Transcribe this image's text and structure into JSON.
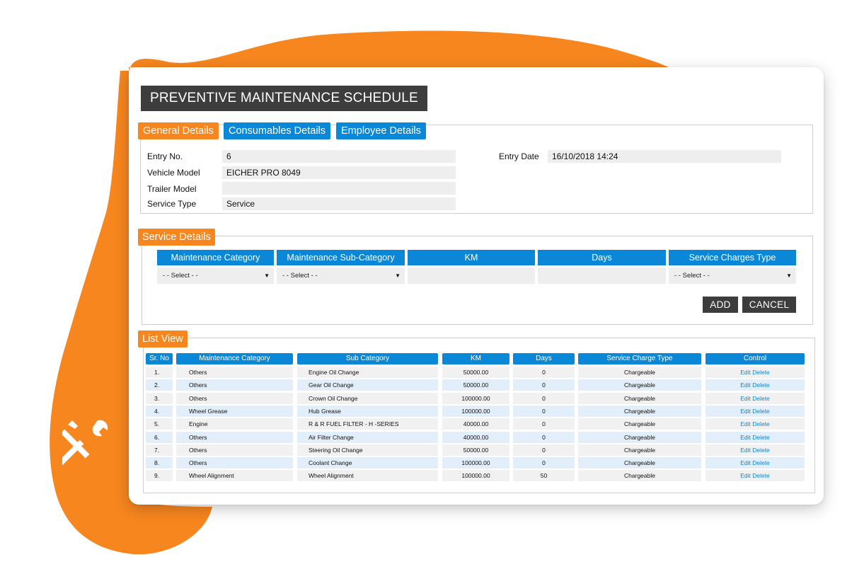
{
  "page_title": "PREVENTIVE MAINTENANCE SCHEDULE",
  "colors": {
    "accent_orange": "#f7861e",
    "header_blue": "#0a87d6",
    "dark_button": "#3d3d3d"
  },
  "tabs": [
    {
      "label": "General Details",
      "active": true
    },
    {
      "label": "Consumables Details",
      "active": false
    },
    {
      "label": "Employee Details",
      "active": false
    }
  ],
  "general": {
    "entry_no_label": "Entry No.",
    "entry_no_value": "6",
    "vehicle_model_label": "Vehicle Model",
    "vehicle_model_value": "EICHER PRO 8049",
    "trailer_model_label": "Trailer Model",
    "trailer_model_value": "",
    "service_type_label": "Service Type",
    "service_type_value": "Service",
    "entry_date_label": "Entry Date",
    "entry_date_value": "16/10/2018 14:24"
  },
  "service_details": {
    "legend": "Service Details",
    "headers": [
      "Maintenance Category",
      "Maintenance Sub-Category",
      "KM",
      "Days",
      "Service Charges Type"
    ],
    "maintenance_category_value": "- - Select - -",
    "maintenance_subcategory_value": "- - Select - -",
    "km_value": "",
    "days_value": "",
    "service_charges_type_value": "- - Select - -",
    "add_label": "ADD",
    "cancel_label": "CANCEL"
  },
  "list_view": {
    "legend": "List View",
    "headers": [
      "Sr. No",
      "Maintenance Category",
      "Sub Category",
      "KM",
      "Days",
      "Service Charge Type",
      "Control"
    ],
    "rows": [
      {
        "sr": "1.",
        "category": "Others",
        "sub": "Engine Oil Change",
        "km": "50000.00",
        "days": "0",
        "charge": "Chargeable",
        "control": "Edit Delete"
      },
      {
        "sr": "2.",
        "category": "Others",
        "sub": "Gear Oil Change",
        "km": "50000.00",
        "days": "0",
        "charge": "Chargeable",
        "control": "Edit Delete"
      },
      {
        "sr": "3.",
        "category": "Others",
        "sub": "Crown Oil Change",
        "km": "100000.00",
        "days": "0",
        "charge": "Chargeable",
        "control": "Edit Delete"
      },
      {
        "sr": "4.",
        "category": "Wheel Grease",
        "sub": "Hub Grease",
        "km": "100000.00",
        "days": "0",
        "charge": "Chargeable",
        "control": "Edit Delete"
      },
      {
        "sr": "5.",
        "category": "Engine",
        "sub": "R & R FUEL FILTER - H -SERIES",
        "km": "40000.00",
        "days": "0",
        "charge": "Chargeable",
        "control": "Edit Delete"
      },
      {
        "sr": "6.",
        "category": "Others",
        "sub": "Air Filter Change",
        "km": "40000.00",
        "days": "0",
        "charge": "Chargeable",
        "control": "Edit Delete"
      },
      {
        "sr": "7.",
        "category": "Others",
        "sub": "Steering Oil Change",
        "km": "50000.00",
        "days": "0",
        "charge": "Chargeable",
        "control": "Edit Delete"
      },
      {
        "sr": "8.",
        "category": "Others",
        "sub": "Coolant Change",
        "km": "100000.00",
        "days": "0",
        "charge": "Chargeable",
        "control": "Edit Delete"
      },
      {
        "sr": "9.",
        "category": "Wheel Alignment",
        "sub": "Wheel Alignment",
        "km": "100000.00",
        "days": "50",
        "charge": "Chargeable",
        "control": "Edit Delete"
      }
    ]
  },
  "icons": {
    "decoration": "wrench-screwdriver-icon"
  }
}
